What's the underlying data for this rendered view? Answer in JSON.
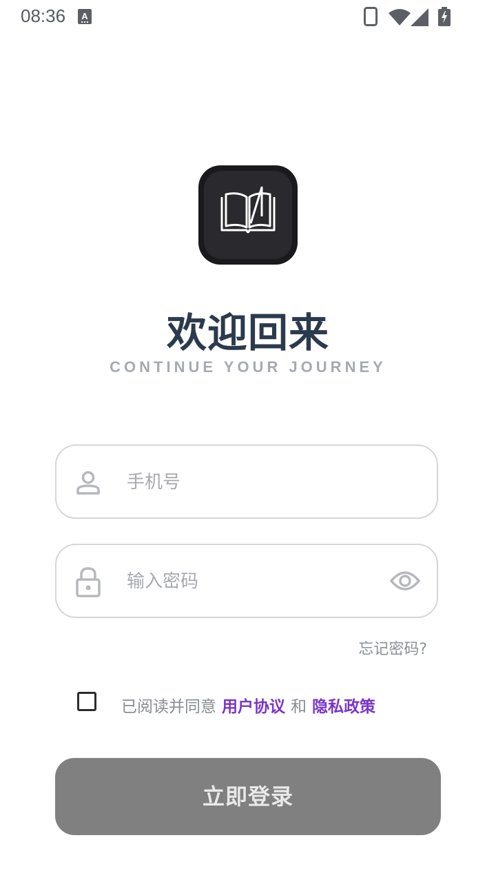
{
  "status_bar": {
    "time": "08:36",
    "icons": [
      "notification-a-icon",
      "phone-icon",
      "wifi-icon",
      "signal-icon",
      "battery-charging-icon"
    ]
  },
  "app": {
    "logo_icon": "open-book-icon",
    "title": "欢迎回来",
    "subtitle": "CONTINUE YOUR JOURNEY"
  },
  "form": {
    "phone": {
      "placeholder": "手机号",
      "value": "",
      "icon": "user-icon"
    },
    "password": {
      "placeholder": "输入密码",
      "value": "",
      "icon": "lock-icon",
      "toggle_icon": "eye-icon"
    },
    "forgot_password": "忘记密码?",
    "agreement": {
      "checked": false,
      "prefix": "已阅读并同意",
      "user_agreement": "用户协议",
      "joiner": "和",
      "privacy_policy": "隐私政策"
    },
    "login_button": "立即登录"
  },
  "colors": {
    "title": "#2b3a4d",
    "subtitle": "#a5aab2",
    "link_accent": "#7a34c9",
    "button_disabled": "#808080",
    "field_border": "#d6d6da",
    "logo_bg": "#1a191d"
  }
}
